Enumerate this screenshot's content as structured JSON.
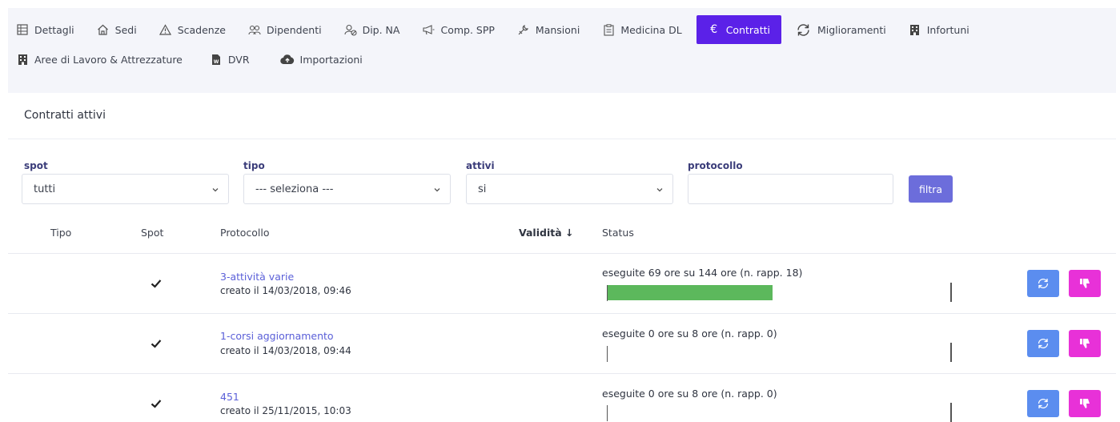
{
  "nav": {
    "row1": [
      {
        "label": "Dettagli",
        "icon": "grid-icon"
      },
      {
        "label": "Sedi",
        "icon": "home-icon"
      },
      {
        "label": "Scadenze",
        "icon": "warning-icon"
      },
      {
        "label": "Dipendenti",
        "icon": "users-icon"
      },
      {
        "label": "Dip. NA",
        "icon": "users-off-icon"
      },
      {
        "label": "Comp. SPP",
        "icon": "megaphone-icon"
      },
      {
        "label": "Mansioni",
        "icon": "tools-icon"
      },
      {
        "label": "Medicina DL",
        "icon": "clipboard-icon"
      },
      {
        "label": "Contratti",
        "icon": "euro-icon",
        "active": true
      },
      {
        "label": "Miglioramenti",
        "icon": "refresh-icon"
      },
      {
        "label": "Infortuni",
        "icon": "building-icon"
      }
    ],
    "row2": [
      {
        "label": "Aree di Lavoro & Attrezzature",
        "icon": "building-alt-icon"
      },
      {
        "label": "DVR",
        "icon": "word-file-icon"
      },
      {
        "label": "Importazioni",
        "icon": "cloud-upload-icon"
      }
    ]
  },
  "page": {
    "title": "Contratti attivi"
  },
  "filters": {
    "spot": {
      "label": "spot",
      "value": "tutti"
    },
    "tipo": {
      "label": "tipo",
      "value": "--- seleziona ---"
    },
    "attivi": {
      "label": "attivi",
      "value": "si"
    },
    "protocollo": {
      "label": "protocollo",
      "value": ""
    },
    "button": "filtra"
  },
  "table": {
    "headers": {
      "tipo": "Tipo",
      "spot": "Spot",
      "protocollo": "Protocollo",
      "validita": "Validità ↓",
      "status": "Status"
    },
    "rows": [
      {
        "tipo": "",
        "spot": true,
        "protocollo": "3-attività varie",
        "creato": "creato il 14/03/2018, 09:46",
        "status": "eseguite 69 ore su 144 ore (n. rapp. 18)",
        "progress": 0.479
      },
      {
        "tipo": "",
        "spot": true,
        "protocollo": "1-corsi aggiornamento",
        "creato": "creato il 14/03/2018, 09:44",
        "status": "eseguite 0 ore su 8 ore (n. rapp. 0)",
        "progress": 0
      },
      {
        "tipo": "",
        "spot": true,
        "protocollo": "451",
        "creato": "creato il 25/11/2015, 10:03",
        "status": "eseguite 0 ore su 8 ore (n. rapp. 0)",
        "progress": 0
      }
    ]
  },
  "colors": {
    "accent": "#5b21e8",
    "link": "#5a5fd8",
    "progress": "#5cb85c",
    "refresh": "#5b8def",
    "thumbs": "#e831d8"
  }
}
